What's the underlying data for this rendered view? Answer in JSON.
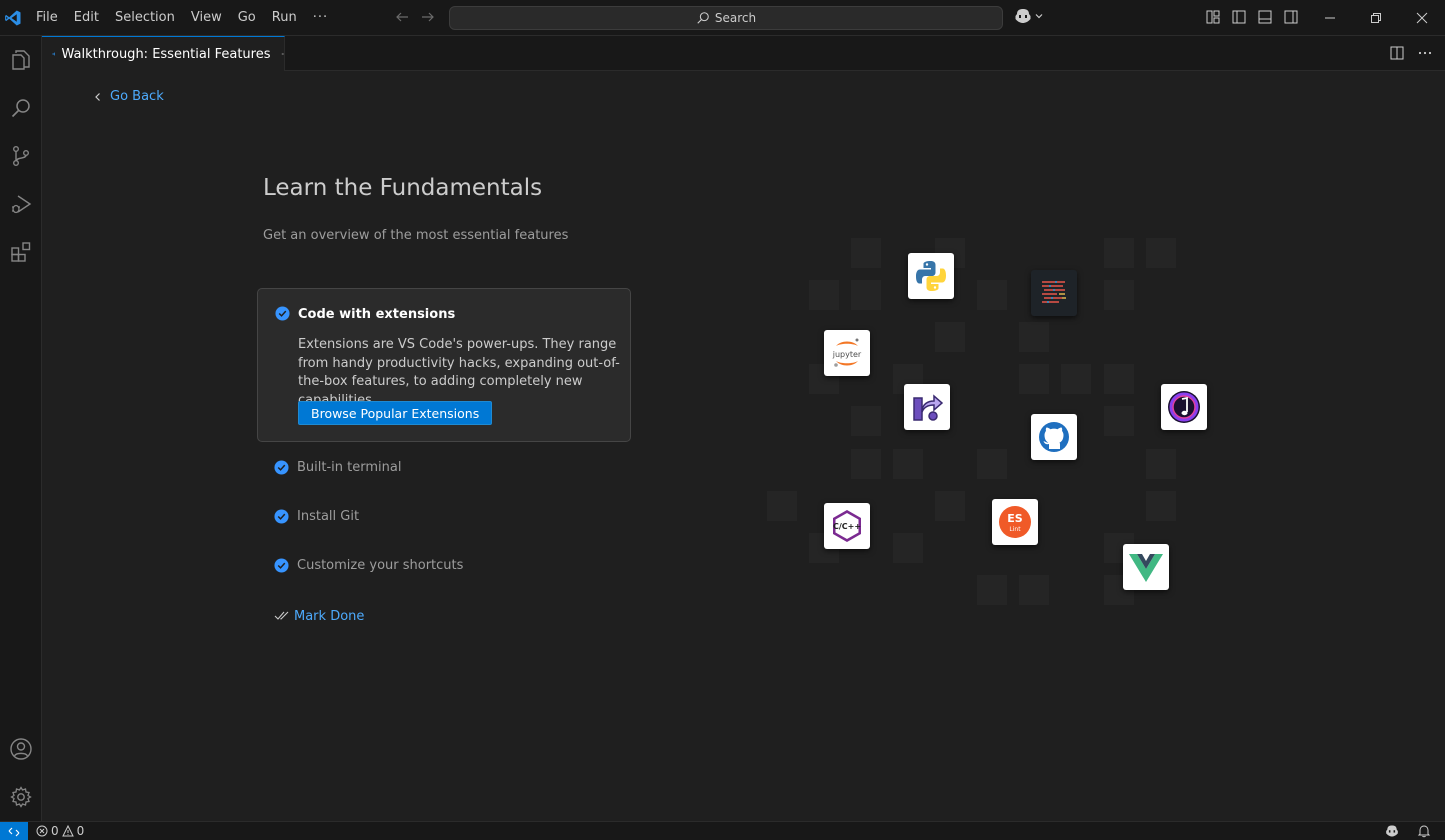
{
  "window": {
    "menu": [
      "File",
      "Edit",
      "Selection",
      "View",
      "Go",
      "Run"
    ],
    "menu_more": "···",
    "search_label": "Search"
  },
  "tab": {
    "label": "Walkthrough: Essential Features"
  },
  "walkthrough": {
    "go_back": "Go Back",
    "title": "Learn the Fundamentals",
    "subtitle": "Get an overview of the most essential features",
    "active_step": {
      "title": "Code with extensions",
      "description": "Extensions are VS Code's power-ups. They range from handy productivity hacks, expanding out-of-the-box features, to adding completely new capabilities.",
      "button": "Browse Popular Extensions"
    },
    "steps": [
      "Built-in terminal",
      "Install Git",
      "Customize your shortcuts"
    ],
    "mark_done": "Mark Done",
    "extension_icons": [
      "python-icon",
      "code-minimap-icon",
      "jupyter-icon",
      "live-share-icon",
      "github-icon",
      "music-extension-icon",
      "cpp-icon",
      "eslint-icon",
      "vue-icon"
    ],
    "eslint_text": [
      "ES",
      "Lint"
    ],
    "cpp_text": "C/C++",
    "jupyter_text": "jupyter"
  },
  "statusbar": {
    "errors": "0",
    "warnings": "0"
  },
  "colors": {
    "accent": "#0078d4",
    "link": "#4daafc",
    "check": "#3794ff"
  }
}
